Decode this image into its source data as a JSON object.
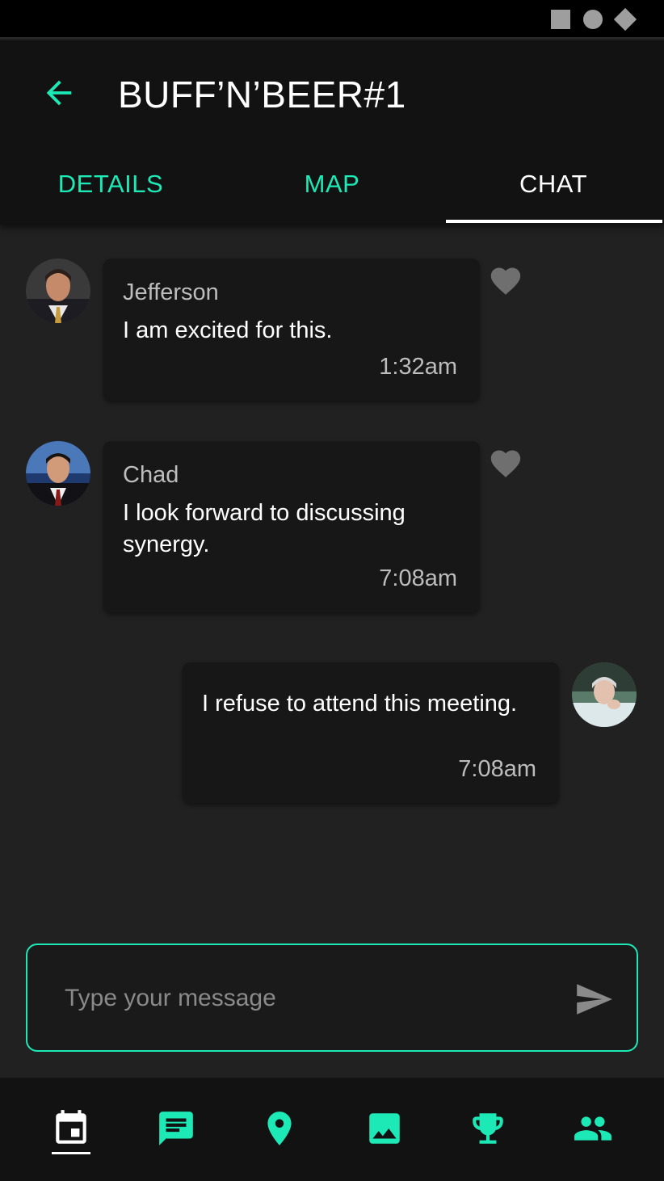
{
  "app": {
    "title": "BUFF’N’BEER#1",
    "accent_color": "#1de9b6"
  },
  "tabs": [
    {
      "label": "DETAILS",
      "active": false
    },
    {
      "label": "MAP",
      "active": false
    },
    {
      "label": "CHAT",
      "active": true
    }
  ],
  "messages": [
    {
      "sender": "Jefferson",
      "text": "I am excited for this.",
      "time": "1:32am",
      "own": false,
      "liked": false
    },
    {
      "sender": "Chad",
      "text": "I look forward to discussing synergy.",
      "time": "7:08am",
      "own": false,
      "liked": false
    },
    {
      "sender": "",
      "text": "I refuse to attend this meeting.",
      "time": "7:08am",
      "own": true
    }
  ],
  "composer": {
    "placeholder": "Type your message",
    "value": ""
  },
  "icons": {
    "back": "arrow-back-icon",
    "like": "heart-icon",
    "send": "send-icon",
    "nav": [
      "calendar-icon",
      "chat-icon",
      "location-pin-icon",
      "image-icon",
      "trophy-icon",
      "people-icon"
    ]
  },
  "bottom_nav": {
    "active_index": 0
  }
}
